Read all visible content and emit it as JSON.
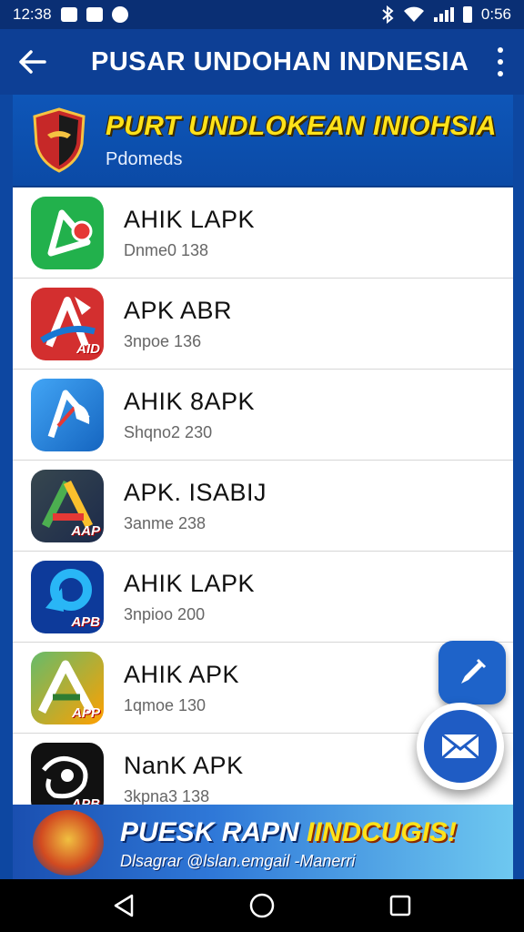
{
  "status_bar": {
    "time_left": "12:38",
    "time_right": "0:56",
    "notification_icons": [
      "image-icon",
      "mail-icon",
      "app-icon"
    ],
    "system_icons": [
      "bluetooth-icon",
      "wifi-icon",
      "signal-icon",
      "battery-icon"
    ]
  },
  "app_bar": {
    "title": "PUSAR UNDOHAN INDNESIA",
    "back_icon": "arrow-left-icon",
    "menu_icon": "more-vert-icon"
  },
  "header": {
    "title": "PURT UNDLOKEAN INIOHSIA",
    "subtitle": "Pdomeds",
    "logo_icon": "shield-logo-icon"
  },
  "apps": [
    {
      "name": "AHIK LAPK",
      "meta": "Dnme0 138",
      "color": "#20b34a",
      "accent": "#e53935",
      "label": ""
    },
    {
      "name": "APK ABR",
      "meta": "3npoe 136",
      "color": "#d32f2f",
      "accent": "#1976d2",
      "label": "AID"
    },
    {
      "name": "AHIK 8APK",
      "meta": "Shqno2 230",
      "color": "#2196f3",
      "accent": "#e53935",
      "label": ""
    },
    {
      "name": "APK. ISABIJ",
      "meta": "3anme 238",
      "color": "#263238",
      "accent": "#4caf50",
      "label": "AAP"
    },
    {
      "name": "AHIK LAPK",
      "meta": "3npioo 200",
      "color": "#0d3a9a",
      "accent": "#29b6f6",
      "label": "APB"
    },
    {
      "name": "AHIK APK",
      "meta": "1qmoe 130",
      "color": "#43a047",
      "accent": "#ff9800",
      "label": "APP"
    },
    {
      "name": "NanK APK",
      "meta": "3kpna3 138",
      "color": "#111111",
      "accent": "#ffffff",
      "label": "APB"
    }
  ],
  "fab": {
    "small_icon": "edit-pen-icon",
    "large_icon": "envelope-icon"
  },
  "banner": {
    "title_left": "PUESK RAPN",
    "title_highlight": "IINDCUGIS!",
    "subtitle": "Dlsagrar @lslan.emgail -Manerri"
  },
  "nav_bar": {
    "icons": [
      "back-triangle-icon",
      "home-circle-icon",
      "recents-square-icon"
    ]
  }
}
